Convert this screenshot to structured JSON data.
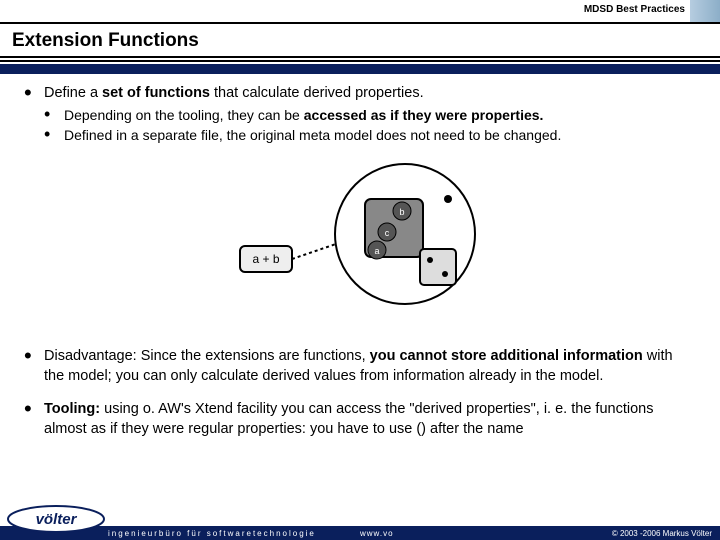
{
  "header": {
    "subtitle": "MDSD Best Practices"
  },
  "title": "Extension Functions",
  "bullets": {
    "b1": {
      "pre": "Define a ",
      "bold1": "set of functions",
      "post": " that calculate derived properties.",
      "sub1": {
        "a": "Depending on the tooling, they can be ",
        "b": "accessed as if they were properties."
      },
      "sub2": "Defined in a separate file, the original meta model does not need to be changed."
    },
    "b2": {
      "a": "Disadvantage: Since the extensions are functions, ",
      "b": "you cannot store additional information",
      "c": " with the model; you can only calculate derived values from information already in the model."
    },
    "b3": {
      "a": "Tooling:",
      "b": " using o. AW's Xtend facility you can access the \"derived properties\", i. e. the functions almost as if they were regular properties: you have to use () after the name"
    }
  },
  "diagram": {
    "ab_label": "a + b",
    "b": "b",
    "c": "c",
    "a": "a"
  },
  "footer": {
    "left": "ingenieurbüro für softwaretechnologie",
    "mid": "www.vo",
    "right": "© 2003 -2006 Markus Völter",
    "logo": "völter"
  }
}
